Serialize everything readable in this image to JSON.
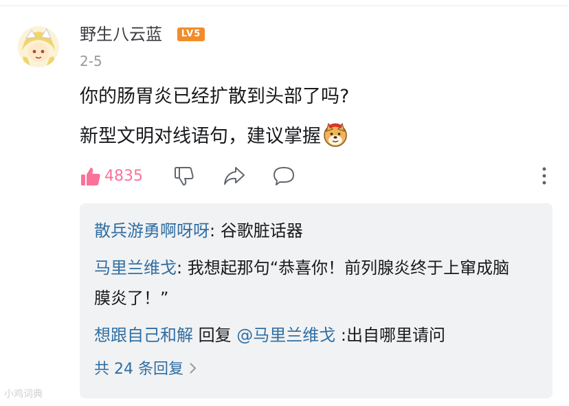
{
  "comment": {
    "username": "野生八云蓝",
    "level": "LV5",
    "date": "2-5",
    "lines": [
      "你的肠胃炎已经扩散到头部了吗?",
      "新型文明对线语句，建议掌握"
    ],
    "emoji": "doge-emoji",
    "actions": {
      "like_count": "4835",
      "icons": [
        "thumbs-up-icon",
        "thumbs-down-icon",
        "share-icon",
        "comment-icon",
        "more-icon"
      ]
    }
  },
  "replies": [
    {
      "name": "散兵游勇啊呀呀",
      "sep": ": ",
      "text": "谷歌脏话器"
    },
    {
      "name": "马里兰维戈",
      "sep": ": ",
      "text": "我想起那句“恭喜你！前列腺炎终于上窜成脑膜炎了！”"
    },
    {
      "name": "想跟自己和解",
      "mid": " 回复 ",
      "target": "@马里兰维戈",
      "sep": " :",
      "text": "出自哪里请问"
    }
  ],
  "reply_count_label": "共 24 条回复",
  "watermark": "小鸡词典",
  "colors": {
    "like": "#fb7299",
    "link": "#2f6ea3",
    "reply_bg": "#f1f2f3",
    "level_badge": "#f28c28"
  }
}
